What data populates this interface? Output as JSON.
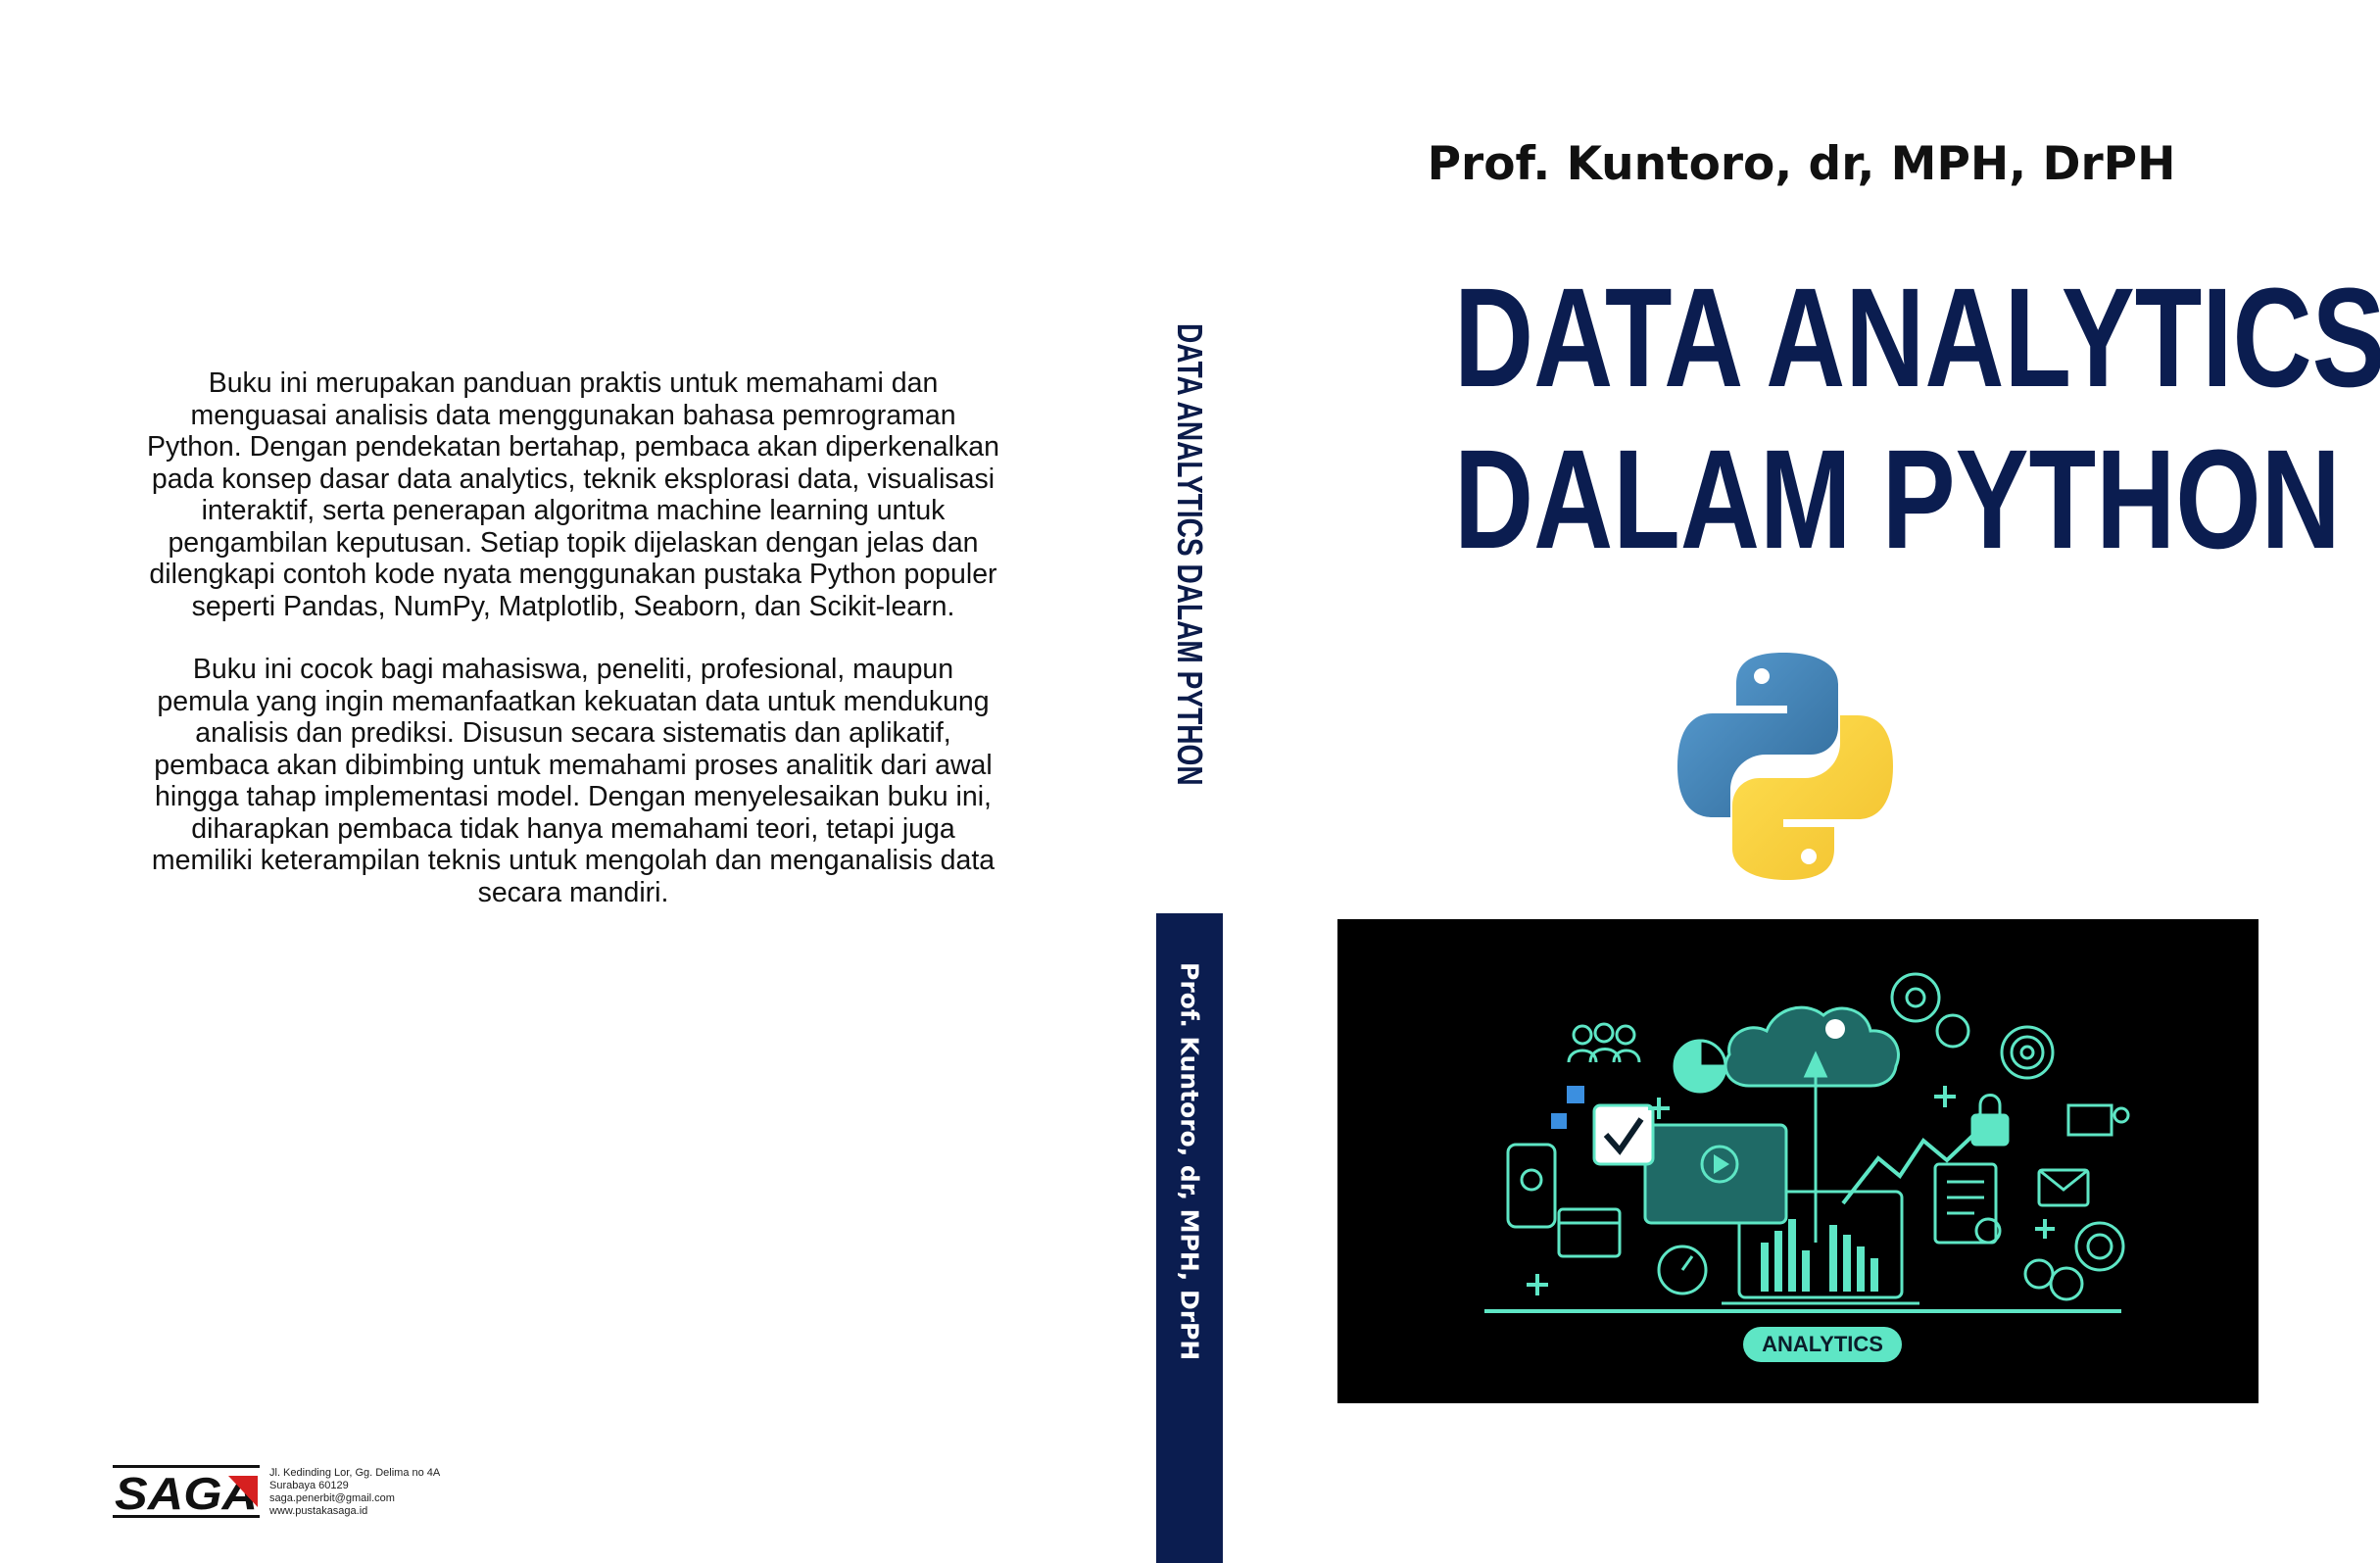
{
  "back_cover": {
    "paragraphs": [
      "Buku ini merupakan panduan praktis untuk memahami dan menguasai analisis data menggunakan bahasa pemrograman Python. Dengan pendekatan bertahap, pembaca akan diperkenalkan pada konsep dasar data analytics, teknik eksplorasi data, visualisasi interaktif, serta penerapan algoritma machine learning untuk pengambilan keputusan. Setiap topik dijelaskan dengan jelas dan dilengkapi contoh kode nyata menggunakan pustaka Python populer seperti Pandas, NumPy, Matplotlib, Seaborn, dan Scikit-learn.",
      "Buku ini cocok bagi mahasiswa, peneliti, profesional, maupun pemula yang ingin memanfaatkan kekuatan data untuk mendukung analisis dan prediksi. Disusun secara sistematis dan aplikatif, pembaca akan dibimbing untuk memahami proses analitik dari awal hingga tahap implementasi model. Dengan menyelesaikan buku ini, diharapkan pembaca tidak hanya memahami teori, tetapi juga memiliki keterampilan teknis untuk mengolah dan menganalisis data secara mandiri."
    ],
    "publisher": {
      "logo_text": "SAGA",
      "address_lines": [
        "Jl. Kedinding Lor, Gg. Delima no 4A",
        "Surabaya 60129",
        "saga.penerbit@gmail.com",
        "www.pustakasaga.id"
      ]
    }
  },
  "spine": {
    "title": "DATA ANALYTICS DALAM PYTHON",
    "author": "Prof. Kuntoro, dr, MPH, DrPH"
  },
  "front_cover": {
    "author": "Prof. Kuntoro, dr, MPH, DrPH",
    "title_line1": "DATA ANALYTICS",
    "title_line2": "DALAM PYTHON",
    "analytics_label": "ANALYTICS"
  },
  "colors": {
    "navy": "#0b1d50",
    "accent": "#5ee6c5",
    "python_blue": "#3b7bbf",
    "python_yellow": "#f7d23e"
  }
}
